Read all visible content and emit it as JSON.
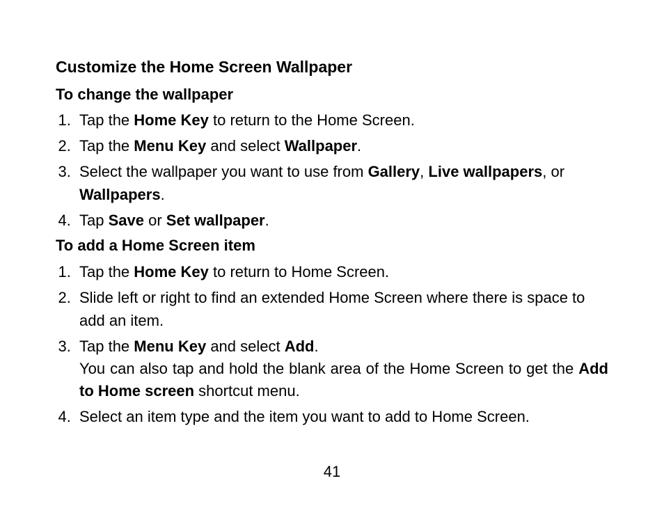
{
  "section_title": "Customize the Home Screen Wallpaper",
  "sub1_title": "To change the wallpaper",
  "s1": {
    "i1_a": "Tap the ",
    "i1_b": "Home Key",
    "i1_c": " to return to the Home Screen.",
    "i2_a": "Tap the ",
    "i2_b": "Menu Key",
    "i2_c": " and select ",
    "i2_d": "Wallpaper",
    "i2_e": ".",
    "i3_a": "Select the wallpaper you want to use from ",
    "i3_b": "Gallery",
    "i3_c": ", ",
    "i3_d": "Live wallpapers",
    "i3_e": ", or ",
    "i3_f": "Wallpapers",
    "i3_g": ".",
    "i4_a": "Tap ",
    "i4_b": "Save",
    "i4_c": " or ",
    "i4_d": "Set wallpaper",
    "i4_e": "."
  },
  "sub2_title": "To add a Home Screen item",
  "s2": {
    "i1_a": "Tap the ",
    "i1_b": "Home Key",
    "i1_c": " to return to Home Screen.",
    "i2": "Slide left or right to find an extended Home Screen where there is space to add an item.",
    "i3_a": "Tap the ",
    "i3_b": "Menu Key",
    "i3_c": " and select ",
    "i3_d": "Add",
    "i3_e": ".",
    "note_a": "You can also tap and hold the blank area of the Home Screen to get the ",
    "note_b": "Add to Home screen",
    "note_c": " shortcut menu.",
    "i4": "Select an item type and the item you want to add to Home Screen."
  },
  "page_number": "41"
}
